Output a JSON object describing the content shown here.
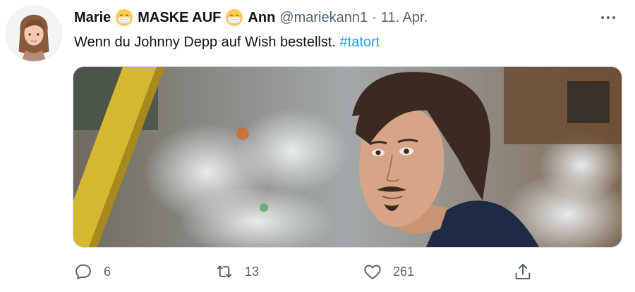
{
  "tweet": {
    "author": {
      "name_part1": "Marie",
      "name_part2": "MASKE AUF",
      "name_part3": "Ann",
      "handle": "@mariekann1",
      "avatar_icon": "avatar-illustration"
    },
    "separator": "·",
    "timestamp": "11. Apr.",
    "text": "Wenn du Johnny Depp auf Wish bestellst.",
    "hashtag": "#tatort",
    "emoji_icon": "face-with-medical-mask-icon",
    "actions": {
      "reply_count": "6",
      "retweet_count": "13",
      "like_count": "261"
    }
  },
  "colors": {
    "text": "#0f1419",
    "secondary": "#536471",
    "link": "#1d9bf0",
    "border": "#cfd9de"
  }
}
